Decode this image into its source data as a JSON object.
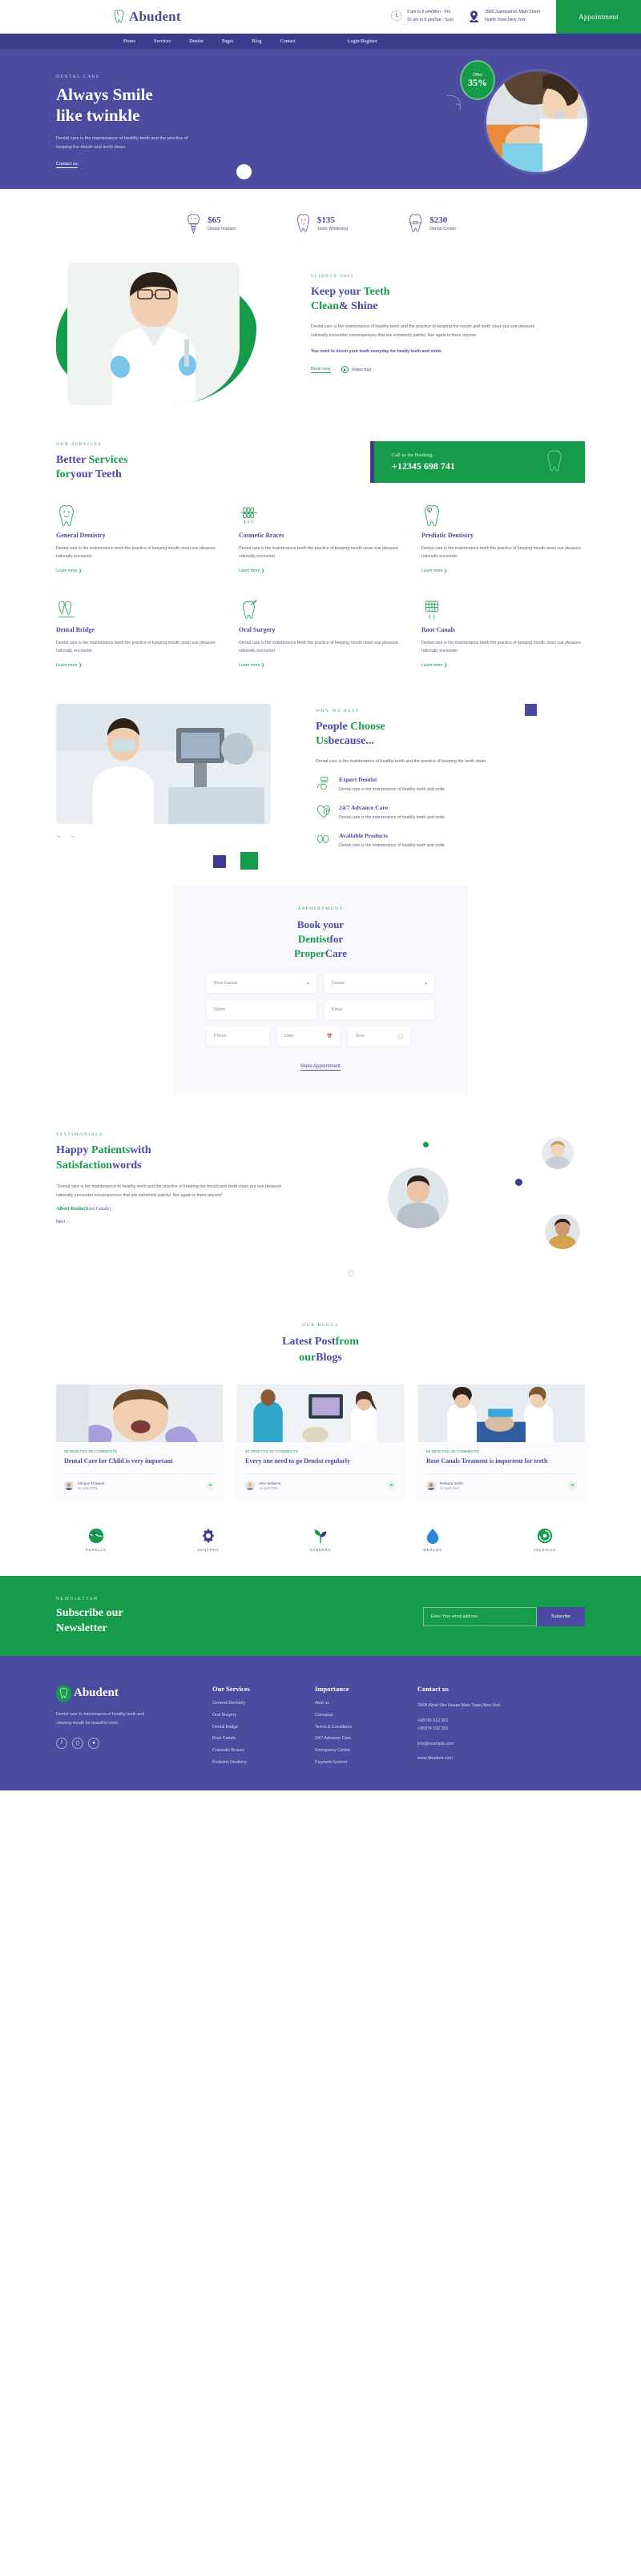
{
  "brand": {
    "name": "Abudent"
  },
  "topbar": {
    "hours": [
      "9 am to 6 pm(Mon - Fri)",
      "10 am to 8 pm(Sat - Sun)"
    ],
    "address": [
      "258C,Saintpatrick,Main Street",
      "Notrth Town,New York"
    ],
    "appointment_button": "Appointment"
  },
  "nav": {
    "items": [
      "Home",
      "Services",
      "Dentist",
      "Pages",
      "Blog",
      "Contact"
    ],
    "login": "Login/Register"
  },
  "hero": {
    "eyebrow": "DENTAL CARE",
    "title_line1": "Always Smile",
    "title_line2": "like twinkle",
    "desc": "Dental care is the maintenance of healthy teeth and the practice of keeping the mouth and teeth clean.",
    "cta": "Contact us",
    "offer_label": "Offer",
    "offer_value": "35%"
  },
  "prices": [
    {
      "amount": "$65",
      "label": "Dental Implant",
      "icon": "tooth-implant-icon"
    },
    {
      "amount": "$135",
      "label": "Teets Whitening",
      "icon": "tooth-smile-icon"
    },
    {
      "amount": "$230",
      "label": "Dental Crown",
      "icon": "tooth-braces-icon"
    }
  ],
  "about": {
    "kicker": "SCIENCE 2005",
    "title_a": "Keep your ",
    "title_b": "Teeth",
    "title_c": "Clean",
    "title_d": "& Shine",
    "desc": "Dental care is the maintenance of healthy teeth and the practice of keeping the mouth and teeth clean pur sue pleasure rationally encounter consequences that are extremely painful. Nor again is there anyone",
    "note": "You need to brush your teeth everyday for healty teeth and simle",
    "book_now": "Book now",
    "video_tour": "Video tour"
  },
  "services": {
    "kicker": "OUR SERVICES",
    "title_a": "Better ",
    "title_b": "Services",
    "title_c": "for",
    "title_d": "your Teeth",
    "call_label": "Call us for Booking",
    "call_number": "+12345 698 741",
    "learn_more": "Learn more",
    "items": [
      {
        "title": "General Dentistry",
        "desc": "Dental care is the maintenance teeth the practice of keeping mouth clean sue pleasure rationally encounter",
        "icon": "tooth-smile-icon"
      },
      {
        "title": "Cosmetic Braces",
        "desc": "Dental care is the maintenance teeth the practice of keeping mouth clean sue pleasure rationally encounter",
        "icon": "braces-icon"
      },
      {
        "title": "Prediatic Dentistry",
        "desc": "Dental care is the maintenance teeth the practice of keeping mouth clean sue pleasure rationally encounter",
        "icon": "tooth-cavity-icon"
      },
      {
        "title": "Dental Bridge",
        "desc": "Dental care is the maintenance teeth the practice of keeping mouth clean sue pleasure rationally encounter",
        "icon": "dental-bridge-icon"
      },
      {
        "title": "Oral Surgery",
        "desc": "Dental care is the maintenance teeth the practice of keeping mouth clean sue pleasure rationally encounter",
        "icon": "oral-surgery-icon"
      },
      {
        "title": "Root Canals",
        "desc": "Dental care is the maintenance teeth the practice of keeping mouth clean sue pleasure rationally encounter",
        "icon": "root-canal-icon"
      }
    ]
  },
  "why": {
    "kicker": "WHY WE BEST",
    "title_a": "People ",
    "title_b": "Choose",
    "title_c": "Us",
    "title_d": "because...",
    "desc": "Dental care is the maintenance of healthy teeth and the practice of keeping the teeth clean",
    "prev": "←",
    "next": "→",
    "features": [
      {
        "title": "Expert Dentist",
        "desc": "Dental care is the maintenance of healthy teeth and smile",
        "icon": "dentist-icon"
      },
      {
        "title": "24/7 Advance Care",
        "desc": "Dental care is the maintenance of healthy teeth and smile",
        "icon": "heart-care-icon"
      },
      {
        "title": "Available Products",
        "desc": "Dental care is the maintenance of healthy teeth and smile",
        "icon": "products-icon"
      }
    ]
  },
  "appointment": {
    "kicker": "APPOINTMENT",
    "title_a": "Book your ",
    "title_b": "Dentist",
    "title_c": "for",
    "title_d": "Proper",
    "title_e": "Care",
    "service_value": "Root Canals",
    "doctor_value": "Doctor",
    "name_placeholder": "Name",
    "email_placeholder": "Email",
    "phone_placeholder": "Phone",
    "date_placeholder": "Date",
    "time_placeholder": "Time",
    "submit": "Make Appointment"
  },
  "testimonials": {
    "kicker": "TESTIMONIALS",
    "title_a": "Happy ",
    "title_b": "Patients",
    "title_c": "with",
    "title_d": "Satisfaction",
    "title_e": "words",
    "quote": "\"Dental care is the maintenance of healthy teeth and the practice of keeping the mouth and teeth clean pur sue pleasure rationally encounter consequences that are extremely painful. Nor again is there anyone\"",
    "author_name": "Albert Rusho",
    "author_role": "(Root Canals)",
    "next": "Next"
  },
  "blog": {
    "kicker": "OUR BLOGS",
    "title_a": "Latest Post",
    "title_b": "from",
    "title_c": "our",
    "title_d": "Blogs",
    "posts": [
      {
        "meta": "30 MINUTES-25 COMMENTS",
        "title": "Dental Care for Child is very important",
        "author": "Morgon Dowson",
        "date": "15 April 2021"
      },
      {
        "meta": "40 MINUTES-52 COMMENTS",
        "title": "Every one need to go Dentist regularly",
        "author": "Alex Williams",
        "date": "18 April 2021"
      },
      {
        "meta": "55 MINUTES-36 COMMENTS",
        "title": "Root Canals Treament is importent for teeth",
        "author": "Rehana Smith",
        "date": "21 April 2021"
      }
    ]
  },
  "brands": [
    {
      "name": "PERELLO",
      "icon": "globe-icon"
    },
    {
      "name": "DENTPRO",
      "icon": "gear-icon"
    },
    {
      "name": "SANDERS",
      "icon": "plant-icon"
    },
    {
      "name": "MERLOS",
      "icon": "drop-icon"
    },
    {
      "name": "SELENIUS",
      "icon": "shield-icon"
    }
  ],
  "newsletter": {
    "kicker": "NEWSLETTER",
    "title_a": "Subscribe our",
    "title_b": "Newsletter",
    "placeholder": "Enter Your email address",
    "button": "Subscribe"
  },
  "footer": {
    "desc": "Dental care is maintenance of healthy teeth and cleaning mouth for beautiful smile",
    "socials": [
      "facebook-icon",
      "instagram-icon",
      "twitter-icon"
    ],
    "columns": [
      {
        "heading": "Our Services",
        "links": [
          "General Dentistry",
          "Oral Surgery",
          "Dental Bridge",
          "Root Canals",
          "Cosmetic Braces",
          "Pediatric Dentistry"
        ]
      },
      {
        "heading": "Importance",
        "links": [
          "Abut us",
          "Comapay",
          "Terms & Conditions",
          "24/7 Advance Care",
          "Emergency Centre",
          "Payment System"
        ]
      }
    ],
    "contact": {
      "heading": "Contact us",
      "address": "256B,West Site House Main Town,New York",
      "phones": "+98745 612 301\n+95874 102 201",
      "email": "info@example.com",
      "site": "www.Abudent.com"
    }
  },
  "colors": {
    "primary": "#4b4ba0",
    "accent": "#169b4b",
    "navy": "#3c3c8c"
  }
}
